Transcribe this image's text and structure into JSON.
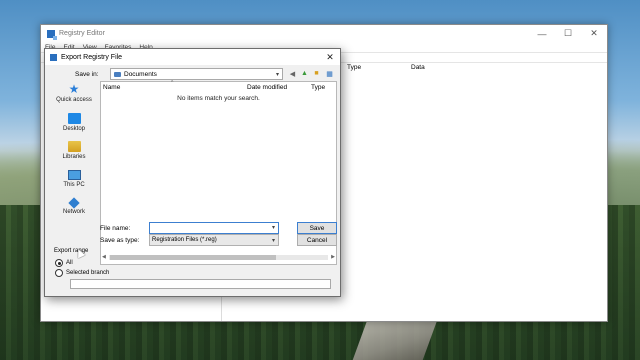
{
  "registry": {
    "title": "Registry Editor",
    "menu": [
      "File",
      "Edit",
      "View",
      "Favorites",
      "Help"
    ],
    "columns": {
      "type": "Type",
      "data": "Data"
    },
    "window_buttons": {
      "minimize": "—",
      "maximize": "☐",
      "close": "✕"
    }
  },
  "dialog": {
    "title": "Export Registry File",
    "close": "✕",
    "save_in_label": "Save in:",
    "save_in_value": "Documents",
    "places": [
      {
        "label": "Quick access",
        "icon": "star-icon"
      },
      {
        "label": "Desktop",
        "icon": "desktop-icon"
      },
      {
        "label": "Libraries",
        "icon": "libraries-icon"
      },
      {
        "label": "This PC",
        "icon": "computer-icon"
      },
      {
        "label": "Network",
        "icon": "network-icon"
      }
    ],
    "list_columns": {
      "name": "Name",
      "date_modified": "Date modified",
      "type": "Type"
    },
    "empty_message": "No items match your search.",
    "file_name_label": "File name:",
    "file_name_value": "",
    "save_as_type_label": "Save as type:",
    "save_as_type_value": "Registration Files (*.reg)",
    "save_button": "Save",
    "cancel_button": "Cancel",
    "export_range_label": "Export range",
    "range_all": "All",
    "range_selected_branch": "Selected branch",
    "selected_range": "All",
    "branch_value": ""
  }
}
